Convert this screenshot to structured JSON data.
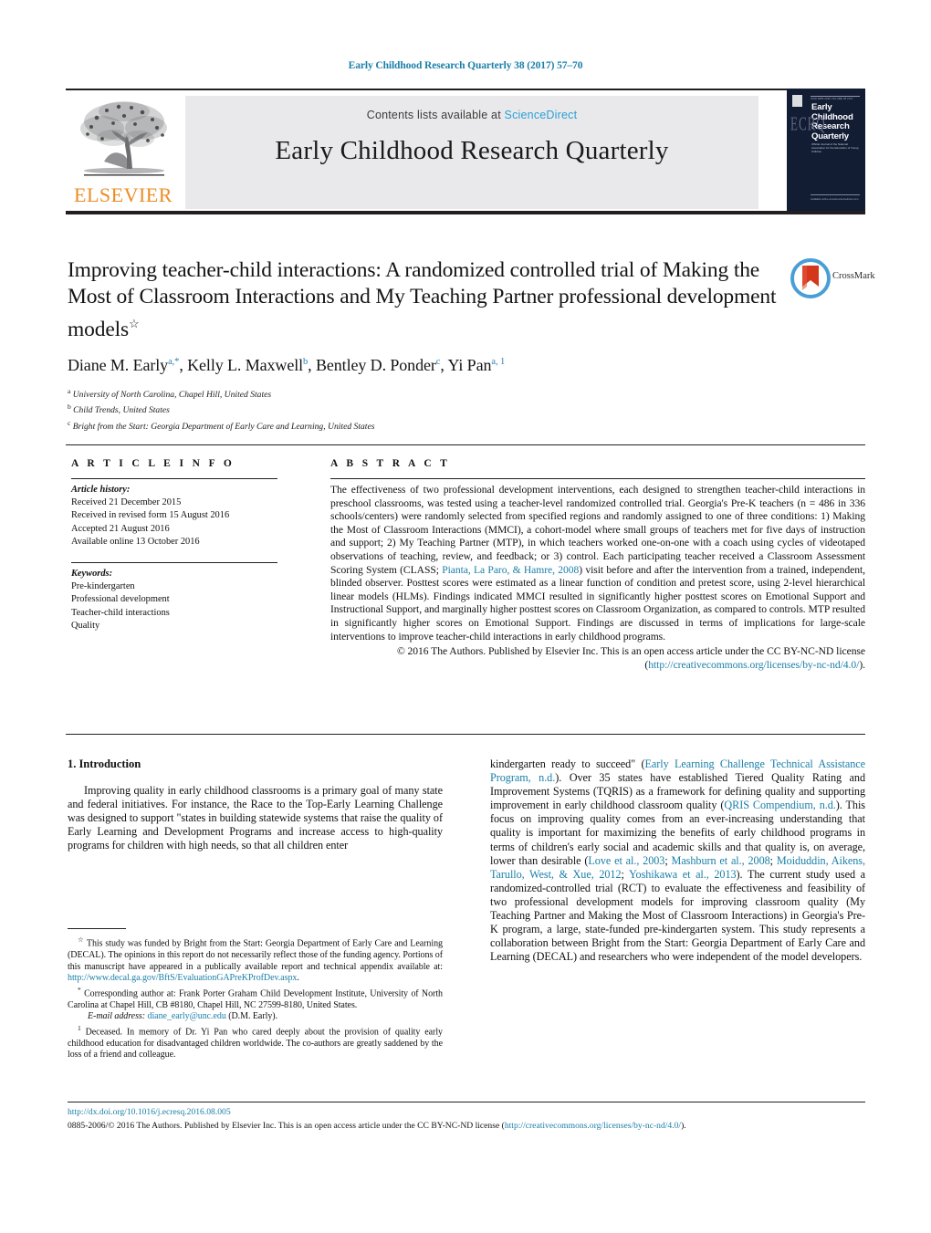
{
  "running_head": "Early Childhood Research Quarterly 38 (2017) 57–70",
  "masthead": {
    "contents_prefix": "Contents lists available at ",
    "sciencedirect": "ScienceDirect",
    "journal_title": "Early Childhood Research Quarterly",
    "elsevier_wordmark": "ELSEVIER",
    "cover": {
      "title": "Early Childhood Research Quarterly",
      "monogram": "ECRQ",
      "subtitle": "Official Journal of the National Association for the Education of Young Children",
      "top_text": "ISSN 0885-2006   VOLUME 38   2017",
      "bottom_text": "Available online at www.sciencedirect.com"
    }
  },
  "article": {
    "title": "Improving teacher-child interactions: A randomized controlled trial of Making the Most of Classroom Interactions and My Teaching Partner professional development models",
    "title_footnote_mark": "☆",
    "authors": [
      {
        "name": "Diane M. Early",
        "marks": "a,*"
      },
      {
        "name": "Kelly L. Maxwell",
        "marks": "b"
      },
      {
        "name": "Bentley D. Ponder",
        "marks": "c"
      },
      {
        "name": "Yi Pan",
        "marks": "a, 1"
      }
    ],
    "affiliations": [
      {
        "mark": "a",
        "text": "University of North Carolina, Chapel Hill, United States"
      },
      {
        "mark": "b",
        "text": "Child Trends, United States"
      },
      {
        "mark": "c",
        "text": "Bright from the Start: Georgia Department of Early Care and Learning, United States"
      }
    ],
    "crossmark_label": "CrossMark"
  },
  "info": {
    "heading": "A R T I C L E   I N F O",
    "history_label": "Article history:",
    "history": [
      "Received 21 December 2015",
      "Received in revised form 15 August 2016",
      "Accepted 21 August 2016",
      "Available online 13 October 2016"
    ],
    "keywords_label": "Keywords:",
    "keywords": [
      "Pre-kindergarten",
      "Professional development",
      "Teacher-child interactions",
      "Quality"
    ]
  },
  "abstract": {
    "heading": "A B S T R A C T",
    "body_part1": "The effectiveness of two professional development interventions, each designed to strengthen teacher-child interactions in preschool classrooms, was tested using a teacher-level randomized controlled trial. Georgia's Pre-K teachers (n = 486 in 336 schools/centers) were randomly selected from specified regions and randomly assigned to one of three conditions: 1) Making the Most of Classroom Interactions (MMCI), a cohort-model where small groups of teachers met for five days of instruction and support; 2) My Teaching Partner (MTP), in which teachers worked one-on-one with a coach using cycles of videotaped observations of teaching, review, and feedback; or 3) control. Each participating teacher received a Classroom Assessment Scoring System (CLASS; ",
    "citation1": "Pianta, La Paro, & Hamre, 2008",
    "body_part2": ") visit before and after the intervention from a trained, independent, blinded observer. Posttest scores were estimated as a linear function of condition and pretest score, using 2-level hierarchical linear models (HLMs). Findings indicated MMCI resulted in significantly higher posttest scores on Emotional Support and Instructional Support, and marginally higher posttest scores on Classroom Organization, as compared to controls. MTP resulted in significantly higher scores on Emotional Support. Findings are discussed in terms of implications for large-scale interventions to improve teacher-child interactions in early childhood programs.",
    "copyright_text": "© 2016 The Authors. Published by Elsevier Inc. This is an open access article under the CC BY-NC-ND license (",
    "license_url": "http://creativecommons.org/licenses/by-nc-nd/4.0/",
    "copyright_close": ")."
  },
  "body": {
    "section_number_title": "1. Introduction",
    "left_paragraph": "Improving quality in early childhood classrooms is a primary goal of many state and federal initiatives. For instance, the Race to the Top-Early Learning Challenge was designed to support \"states in building statewide systems that raise the quality of Early Learning and Development Programs and increase access to high-quality programs for children with high needs, so that all children enter",
    "right_part1": "kindergarten ready to succeed\" (",
    "right_cite1": "Early Learning Challenge Technical Assistance Program, n.d.",
    "right_part2": "). Over 35 states have established Tiered Quality Rating and Improvement Systems (TQRIS) as a framework for defining quality and supporting improvement in early childhood classroom quality (",
    "right_cite2": "QRIS Compendium, n.d.",
    "right_part3": "). This focus on improving quality comes from an ever-increasing understanding that quality is important for maximizing the benefits of early childhood programs in terms of children's early social and academic skills and that quality is, on average, lower than desirable (",
    "right_cite3": "Love et al., 2003",
    "right_sep1": "; ",
    "right_cite4": "Mashburn et al., 2008",
    "right_sep2": "; ",
    "right_cite5": "Moiduddin, Aikens, Tarullo, West, & Xue, 2012",
    "right_sep3": "; ",
    "right_cite6": "Yoshikawa et al., 2013",
    "right_part4": "). The current study used a randomized-controlled trial (RCT) to evaluate the effectiveness and feasibility of two professional development models for improving classroom quality (My Teaching Partner and Making the Most of Classroom Interactions) in Georgia's Pre-K program, a large, state-funded pre-kindergarten system. This study represents a collaboration between Bright from the Start: Georgia Department of Early Care and Learning (DECAL) and researchers who were independent of the model developers."
  },
  "footnotes": {
    "star_mark": "☆",
    "star_text_1": "This study was funded by Bright from the Start: Georgia Department of Early Care and Learning (DECAL). The opinions in this report do not necessarily reflect those of the funding agency. Portions of this manuscript have appeared in a publically available report and technical appendix available at: ",
    "star_link": "http://www.decal.ga.gov/BftS/EvaluationGAPreKProfDev.aspx",
    "star_text_2": ".",
    "corresponding_mark": "*",
    "corresponding_text": "Corresponding author at: Frank Porter Graham Child Development Institute, University of North Carolina at Chapel Hill, CB #8180, Chapel Hill, NC 27599-8180, United States.",
    "email_label": "E-mail address:",
    "email": "diane_early@unc.edu",
    "email_suffix": "(D.M. Early).",
    "deceased_mark": "1",
    "deceased_text": "Deceased. In memory of Dr. Yi Pan who cared deeply about the provision of quality early childhood education for disadvantaged children worldwide. The co-authors are greatly saddened by the loss of a friend and colleague."
  },
  "footer": {
    "doi": "http://dx.doi.org/10.1016/j.ecresq.2016.08.005",
    "issn_copyright": "0885-2006/© 2016 The Authors. Published by Elsevier Inc. This is an open access article under the CC BY-NC-ND license (",
    "license_url": "http://creativecommons.org/licenses/by-nc-nd/4.0/",
    "close": ")."
  },
  "colors": {
    "link_blue": "#1a7fa8",
    "sciencedirect_blue": "#2a9fd4",
    "elsevier_orange": "#ec8c23",
    "cover_navy": "#121c33",
    "band_gray": "#e9e9eb"
  }
}
